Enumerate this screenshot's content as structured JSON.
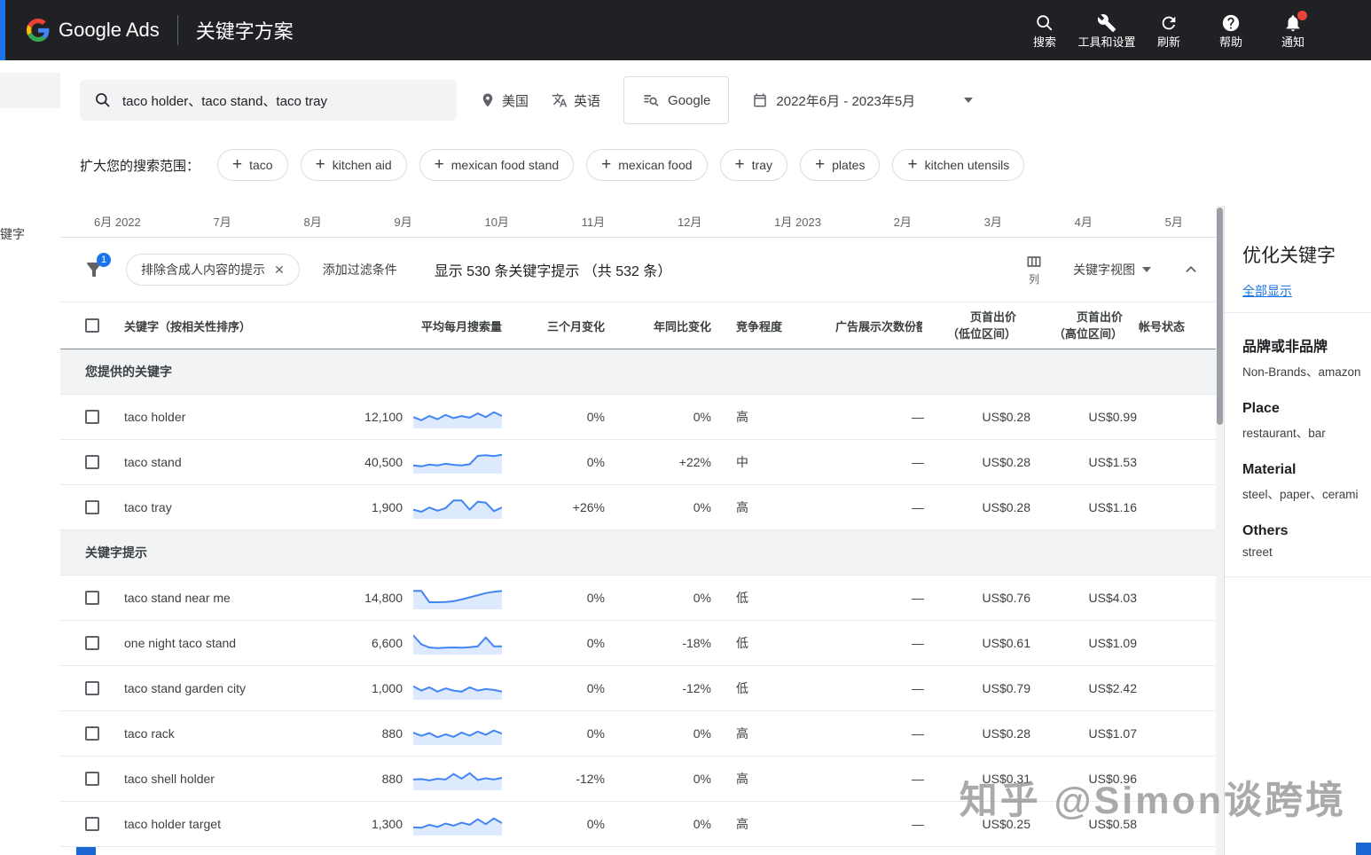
{
  "topbar": {
    "brand": "Google Ads",
    "page_title": "关键字方案",
    "actions": [
      {
        "label": "搜索",
        "icon": "search-icon"
      },
      {
        "label": "工具和设置",
        "icon": "tools-settings-icon"
      },
      {
        "label": "刷新",
        "icon": "refresh-icon"
      },
      {
        "label": "帮助",
        "icon": "help-icon"
      },
      {
        "label": "通知",
        "icon": "notifications-icon",
        "badge": true
      }
    ]
  },
  "left_nav": {
    "partial_item": "键字"
  },
  "query_bar": {
    "keywords": "taco holder、taco stand、taco tray",
    "location": "美国",
    "language": "英语",
    "network": "Google",
    "date_range": "2022年6月 - 2023年5月"
  },
  "broaden": {
    "label": "扩大您的搜索范围：",
    "chips": [
      "taco",
      "kitchen aid",
      "mexican food stand",
      "mexican food",
      "tray",
      "plates",
      "kitchen utensils"
    ]
  },
  "timeline": {
    "months": [
      "6月 2022",
      "7月",
      "8月",
      "9月",
      "10月",
      "11月",
      "12月",
      "1月 2023",
      "2月",
      "3月",
      "4月",
      "5月"
    ]
  },
  "toolbar": {
    "filter_badge": "1",
    "filter_chip": "排除含成人内容的提示",
    "add_filter_label": "添加过滤条件",
    "summary": "显示 530 条关键字提示 （共 532 条）",
    "columns_label": "列",
    "view_label": "关键字视图"
  },
  "table": {
    "headers": {
      "keyword": "关键字（按相关性排序）",
      "volume": "平均每月搜索量",
      "three_month": "三个月变化",
      "yoy": "年同比变化",
      "competition": "竞争程度",
      "impression_share": "广告展示次数份额",
      "low_bid": "页首出价\n（低位区间）",
      "high_bid": "页首出价\n（高位区间）",
      "status": "帐号状态"
    },
    "sections": [
      {
        "title": "您提供的关键字",
        "rows": [
          {
            "keyword": "taco holder",
            "volume": "12,100",
            "spark": [
              0.45,
              0.3,
              0.5,
              0.35,
              0.55,
              0.4,
              0.5,
              0.42,
              0.62,
              0.45,
              0.68,
              0.5
            ],
            "three_month": "0%",
            "yoy": "0%",
            "competition": "高",
            "impression_share": "—",
            "low_bid": "US$0.28",
            "high_bid": "US$0.99"
          },
          {
            "keyword": "taco stand",
            "volume": "40,500",
            "spark": [
              0.3,
              0.26,
              0.34,
              0.3,
              0.38,
              0.33,
              0.3,
              0.36,
              0.75,
              0.78,
              0.74,
              0.8
            ],
            "three_month": "0%",
            "yoy": "+22%",
            "competition": "中",
            "impression_share": "—",
            "low_bid": "US$0.28",
            "high_bid": "US$1.53"
          },
          {
            "keyword": "taco tray",
            "volume": "1,900",
            "spark": [
              0.35,
              0.25,
              0.45,
              0.3,
              0.42,
              0.78,
              0.78,
              0.35,
              0.72,
              0.68,
              0.28,
              0.45
            ],
            "three_month": "+26%",
            "yoy": "0%",
            "competition": "高",
            "impression_share": "—",
            "low_bid": "US$0.28",
            "high_bid": "US$1.16"
          }
        ]
      },
      {
        "title": "关键字提示",
        "rows": [
          {
            "keyword": "taco stand near me",
            "volume": "14,800",
            "spark": [
              0.78,
              0.78,
              0.25,
              0.25,
              0.26,
              0.3,
              0.38,
              0.48,
              0.58,
              0.68,
              0.74,
              0.78
            ],
            "three_month": "0%",
            "yoy": "0%",
            "competition": "低",
            "impression_share": "—",
            "low_bid": "US$0.76",
            "high_bid": "US$4.03"
          },
          {
            "keyword": "one night taco stand",
            "volume": "6,600",
            "spark": [
              0.82,
              0.4,
              0.25,
              0.22,
              0.24,
              0.25,
              0.24,
              0.26,
              0.3,
              0.72,
              0.3,
              0.3
            ],
            "three_month": "0%",
            "yoy": "-18%",
            "competition": "低",
            "impression_share": "—",
            "low_bid": "US$0.61",
            "high_bid": "US$1.09"
          },
          {
            "keyword": "taco stand garden city",
            "volume": "1,000",
            "spark": [
              0.55,
              0.35,
              0.5,
              0.3,
              0.45,
              0.35,
              0.3,
              0.5,
              0.35,
              0.42,
              0.38,
              0.3
            ],
            "three_month": "0%",
            "yoy": "-12%",
            "competition": "低",
            "impression_share": "—",
            "low_bid": "US$0.79",
            "high_bid": "US$2.42"
          },
          {
            "keyword": "taco rack",
            "volume": "880",
            "spark": [
              0.5,
              0.35,
              0.48,
              0.28,
              0.42,
              0.3,
              0.5,
              0.36,
              0.55,
              0.4,
              0.6,
              0.45
            ],
            "three_month": "0%",
            "yoy": "0%",
            "competition": "高",
            "impression_share": "—",
            "low_bid": "US$0.28",
            "high_bid": "US$1.07"
          },
          {
            "keyword": "taco shell holder",
            "volume": "880",
            "spark": [
              0.42,
              0.44,
              0.38,
              0.46,
              0.42,
              0.68,
              0.46,
              0.72,
              0.4,
              0.48,
              0.42,
              0.5
            ],
            "three_month": "-12%",
            "yoy": "0%",
            "competition": "高",
            "impression_share": "—",
            "low_bid": "US$0.31",
            "high_bid": "US$0.96"
          },
          {
            "keyword": "taco holder target",
            "volume": "1,300",
            "spark": [
              0.3,
              0.28,
              0.42,
              0.32,
              0.48,
              0.38,
              0.52,
              0.42,
              0.68,
              0.45,
              0.72,
              0.5
            ],
            "three_month": "0%",
            "yoy": "0%",
            "competition": "高",
            "impression_share": "—",
            "low_bid": "US$0.25",
            "high_bid": "US$0.58"
          }
        ]
      }
    ]
  },
  "refine_panel": {
    "title": "优化关键字",
    "show_all": "全部显示",
    "groups": [
      {
        "name": "品牌或非品牌",
        "values": "Non-Brands、amazon"
      },
      {
        "name": "Place",
        "values": "restaurant、bar"
      },
      {
        "name": "Material",
        "values": "steel、paper、cerami"
      },
      {
        "name": "Others",
        "values": "street"
      }
    ]
  },
  "watermark": "知乎 @Simon谈跨境"
}
